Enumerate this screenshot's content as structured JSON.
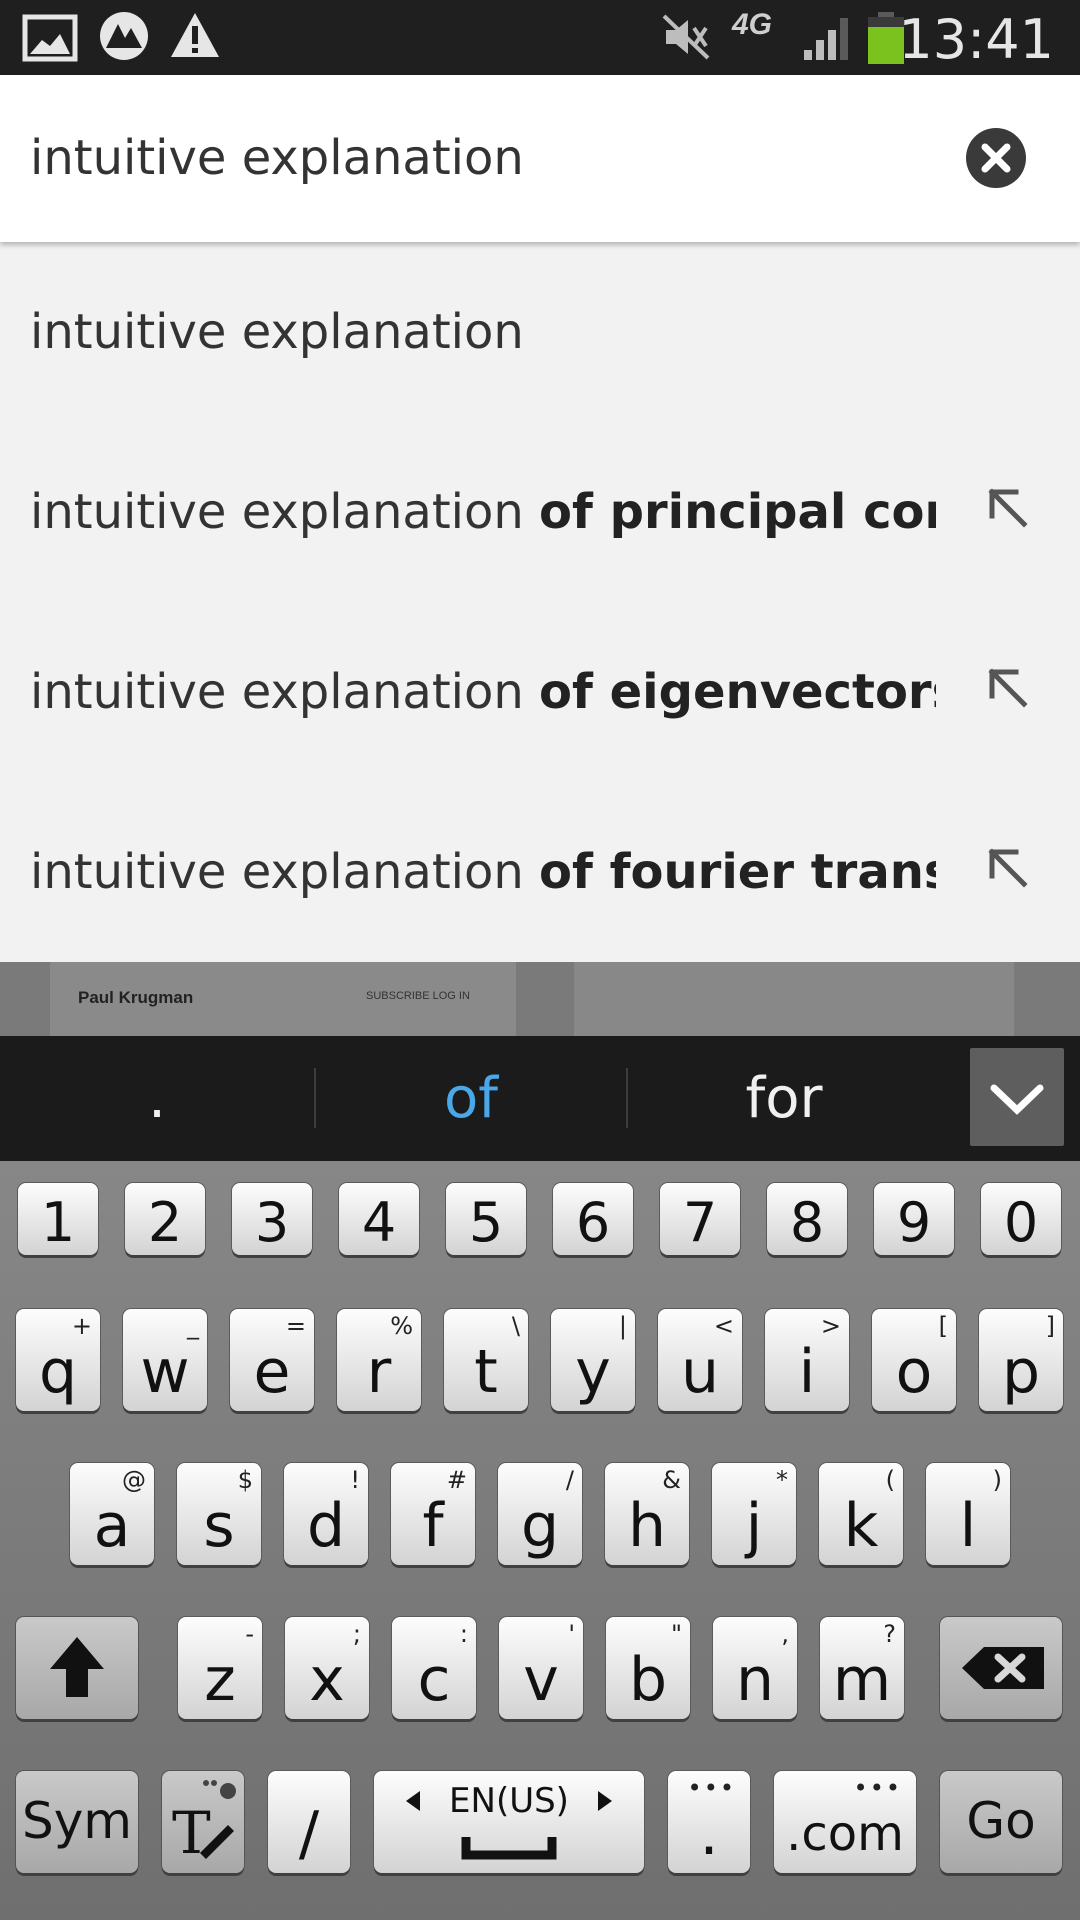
{
  "status_bar": {
    "time": "13:41",
    "network": "4G",
    "icons": [
      "gallery-icon",
      "app-icon",
      "warning-icon",
      "mute-icon",
      "signal-icon",
      "battery-icon"
    ]
  },
  "search": {
    "query": "intuitive explanation",
    "clear_icon": "close-icon"
  },
  "suggestions": [
    {
      "prefix": "intuitive explanation",
      "suffix": ""
    },
    {
      "prefix": "intuitive explanation ",
      "suffix": "of principal compo"
    },
    {
      "prefix": "intuitive explanation ",
      "suffix": "of eigenvectors"
    },
    {
      "prefix": "intuitive explanation ",
      "suffix": "of fourier transforn"
    }
  ],
  "underlay": {
    "author": "Paul Krugman",
    "links": "SUBSCRIBE   LOG IN"
  },
  "prediction_bar": {
    "words": [
      ".",
      "of",
      "for"
    ],
    "highlight_color": "#4aa8e8"
  },
  "keyboard": {
    "numbers": [
      "1",
      "2",
      "3",
      "4",
      "5",
      "6",
      "7",
      "8",
      "9",
      "0"
    ],
    "row1": [
      {
        "k": "q",
        "s": "+"
      },
      {
        "k": "w",
        "s": "_"
      },
      {
        "k": "e",
        "s": "="
      },
      {
        "k": "r",
        "s": "%"
      },
      {
        "k": "t",
        "s": "\\"
      },
      {
        "k": "y",
        "s": "|"
      },
      {
        "k": "u",
        "s": "<"
      },
      {
        "k": "i",
        "s": ">"
      },
      {
        "k": "o",
        "s": "["
      },
      {
        "k": "p",
        "s": "]"
      }
    ],
    "row2": [
      {
        "k": "a",
        "s": "@"
      },
      {
        "k": "s",
        "s": "$"
      },
      {
        "k": "d",
        "s": "!"
      },
      {
        "k": "f",
        "s": "#"
      },
      {
        "k": "g",
        "s": "/"
      },
      {
        "k": "h",
        "s": "&"
      },
      {
        "k": "j",
        "s": "*"
      },
      {
        "k": "k",
        "s": "("
      },
      {
        "k": "l",
        "s": ")"
      }
    ],
    "row3": [
      {
        "k": "z",
        "s": "-"
      },
      {
        "k": "x",
        "s": ";"
      },
      {
        "k": "c",
        "s": ":"
      },
      {
        "k": "v",
        "s": "'"
      },
      {
        "k": "b",
        "s": "\""
      },
      {
        "k": "n",
        "s": ","
      },
      {
        "k": "m",
        "s": "?"
      }
    ],
    "sym": "Sym",
    "slash": "/",
    "language": "EN(US)",
    "period": ".",
    "dotcom": ".com",
    "go": "Go"
  }
}
